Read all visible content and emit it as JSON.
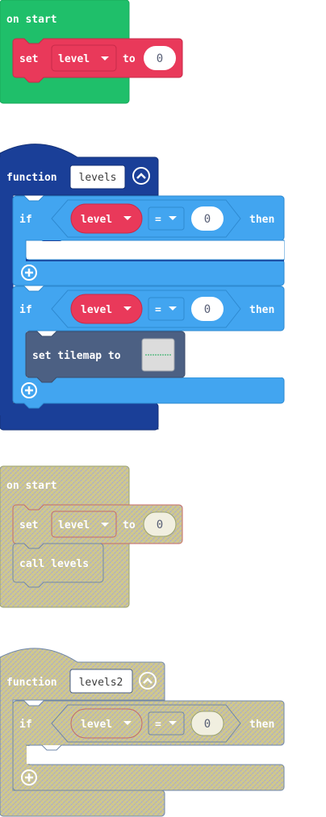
{
  "colors": {
    "event_green": "#1fbf6a",
    "variable_red": "#e9395a",
    "function_blue": "#1a3f98",
    "logic_blue": "#42a5f0",
    "scene_slate": "#4c6083",
    "disabled_fill": "#c9c493",
    "disabled_stroke": "#6f87a8"
  },
  "blocks": {
    "on_start_1": {
      "hat_label": "on start",
      "set_label": "set",
      "variable": "level",
      "to_label": "to",
      "value": "0"
    },
    "function_1": {
      "keyword": "function",
      "name": "levels",
      "if_1": {
        "if_label": "if",
        "variable": "level",
        "operator": "=",
        "value": "0",
        "then_label": "then"
      },
      "if_2": {
        "if_label": "if",
        "variable": "level",
        "operator": "=",
        "value": "0",
        "then_label": "then",
        "body_label": "set tilemap to"
      }
    },
    "on_start_2": {
      "hat_label": "on start",
      "set_label": "set",
      "variable": "level",
      "to_label": "to",
      "value": "0",
      "call_label": "call levels"
    },
    "function_2": {
      "keyword": "function",
      "name": "levels2",
      "if_1": {
        "if_label": "if",
        "variable": "level",
        "operator": "=",
        "value": "0",
        "then_label": "then"
      }
    }
  }
}
